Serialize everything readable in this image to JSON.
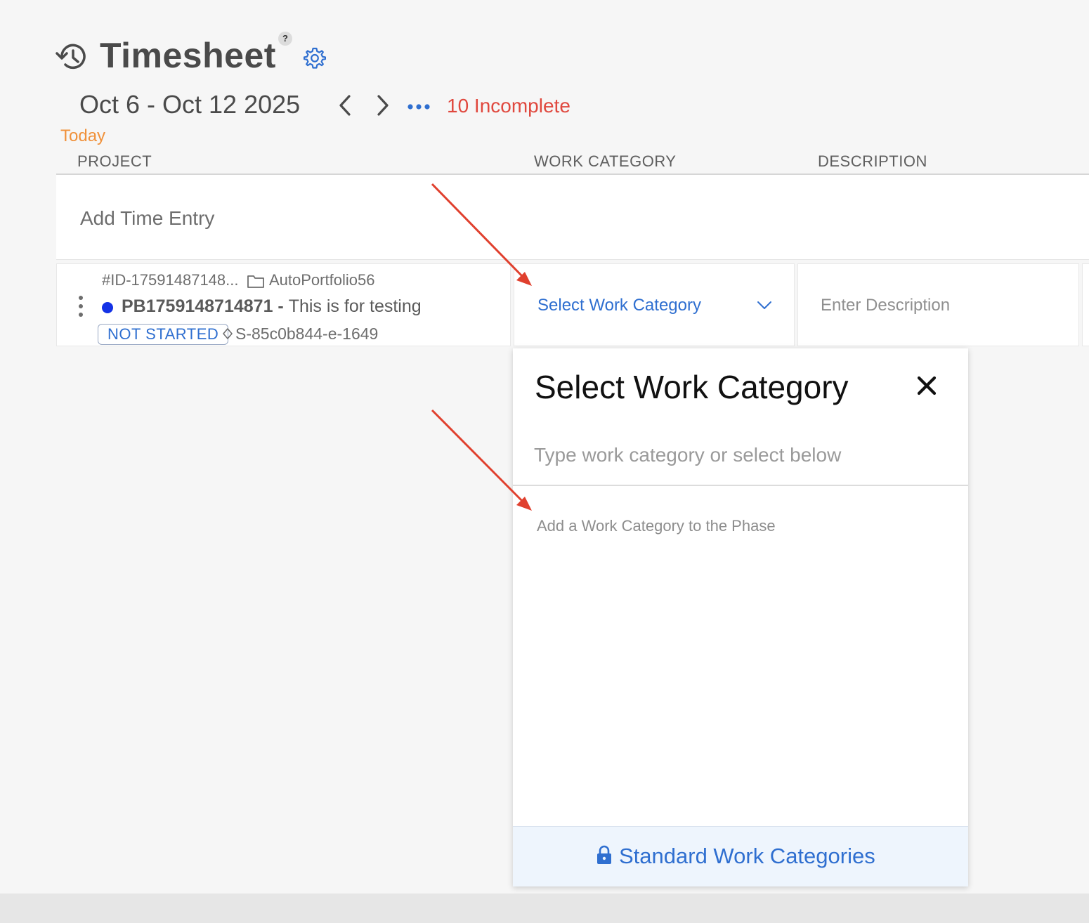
{
  "header": {
    "title": "Timesheet",
    "help_label": "?",
    "date_range": "Oct 6 - Oct 12 2025",
    "incomplete": "10 Incomplete",
    "today": "Today"
  },
  "columns": {
    "project": "PROJECT",
    "work_category": "WORK CATEGORY",
    "description": "DESCRIPTION"
  },
  "add_entry": {
    "label": "Add Time Entry"
  },
  "entry": {
    "id": "#ID-17591487148...",
    "portfolio": "AutoPortfolio56",
    "project_code": "PB1759148714871",
    "separator": " - ",
    "project_description": "This is for testing",
    "status": "NOT STARTED",
    "phase_id": "S-85c0b844-e-1649",
    "work_category_value": "Select Work Category",
    "description_placeholder": "Enter Description"
  },
  "dropdown": {
    "title": "Select Work Category",
    "search_placeholder": "Type work category or select below",
    "empty_message": "Add a Work Category to the Phase",
    "footer_label": "Standard Work Categories"
  },
  "colors": {
    "accent_blue": "#2f6fd0",
    "incomplete_red": "#e0483e",
    "today_orange": "#f0913a",
    "status_dot": "#1432e6",
    "annotation_arrow": "#e0402e"
  },
  "icons": [
    "history-icon",
    "help-icon",
    "gear-icon",
    "chevron-left-icon",
    "chevron-right-icon",
    "more-icon",
    "kebab-menu-icon",
    "folder-icon",
    "diamond-icon",
    "chevron-down-icon",
    "close-icon",
    "lock-icon"
  ]
}
